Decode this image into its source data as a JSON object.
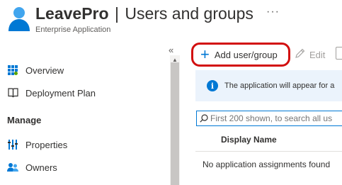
{
  "header": {
    "app_name": "LeavePro",
    "separator": "|",
    "page_title": "Users and groups",
    "subtitle": "Enterprise Application",
    "more_label": "···"
  },
  "sidebar": {
    "collapse_label": "«",
    "items": [
      {
        "label": "Overview",
        "icon": "grid-icon"
      },
      {
        "label": "Deployment Plan",
        "icon": "book-icon"
      }
    ],
    "section_header": "Manage",
    "manage_items": [
      {
        "label": "Properties",
        "icon": "properties-icon"
      },
      {
        "label": "Owners",
        "icon": "users-icon"
      }
    ]
  },
  "toolbar": {
    "add_label": "Add user/group",
    "add_icon": "plus-icon",
    "edit_label": "Edit",
    "edit_icon": "pencil-icon"
  },
  "banner": {
    "icon": "info-icon",
    "text": "The application will appear for a"
  },
  "search": {
    "placeholder": "First 200 shown, to search all us",
    "icon": "search-icon"
  },
  "table": {
    "columns": [
      "Display Name"
    ],
    "empty_message": "No application assignments found"
  },
  "colors": {
    "accent": "#0078d4",
    "highlight_border": "#d20f0f",
    "banner_bg": "#ebf3fc"
  }
}
